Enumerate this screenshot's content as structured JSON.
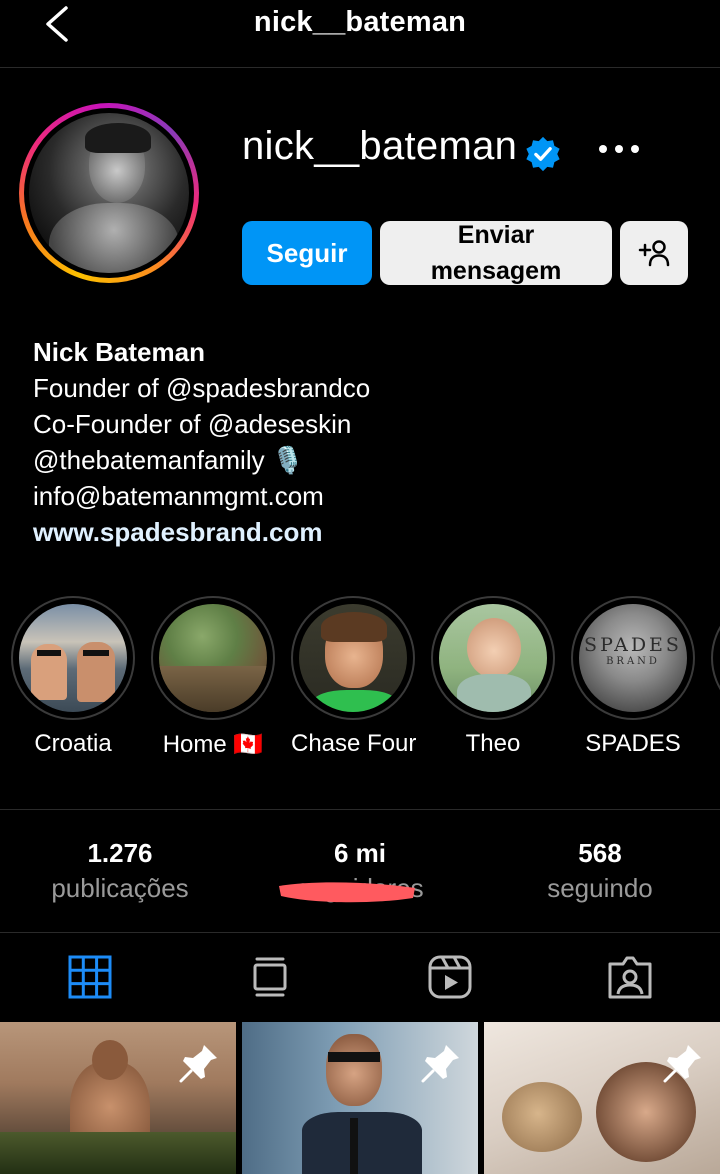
{
  "topbar": {
    "title": "nick__bateman",
    "back_icon": "chevron-left-icon"
  },
  "profile": {
    "username": "nick__bateman",
    "verified": true,
    "accent": "#0095f6",
    "buttons": {
      "follow": "Seguir",
      "message_line1": "Enviar",
      "message_line2": "mensagem",
      "add_user_icon": "add-user-icon"
    }
  },
  "bio": {
    "name": "Nick Bateman",
    "line1": "Founder of @spadesbrandco",
    "line2": "Co-Founder of @adeseskin",
    "line3": "@thebatemanfamily 🎙️",
    "line4": "info@batemanmgmt.com",
    "link": "www.spadesbrand.com"
  },
  "highlights": [
    {
      "label": "Croatia"
    },
    {
      "label": "Home 🇨🇦"
    },
    {
      "label": "Chase Four"
    },
    {
      "label": "Theo"
    },
    {
      "label": "SPADES"
    }
  ],
  "highlight_spades_text": {
    "line1": "SPADES",
    "line2": "BRAND"
  },
  "stats": [
    {
      "value": "1.276",
      "label": "publicações"
    },
    {
      "value": "6 mi",
      "label": "seguidores"
    },
    {
      "value": "568",
      "label": "seguindo"
    }
  ],
  "tabs": [
    "grid-icon",
    "feed-icon",
    "reels-icon",
    "tagged-icon"
  ],
  "tab_active_color": "#1d8cf8",
  "posts": [
    {
      "pinned": true
    },
    {
      "pinned": true
    },
    {
      "pinned": true
    }
  ]
}
